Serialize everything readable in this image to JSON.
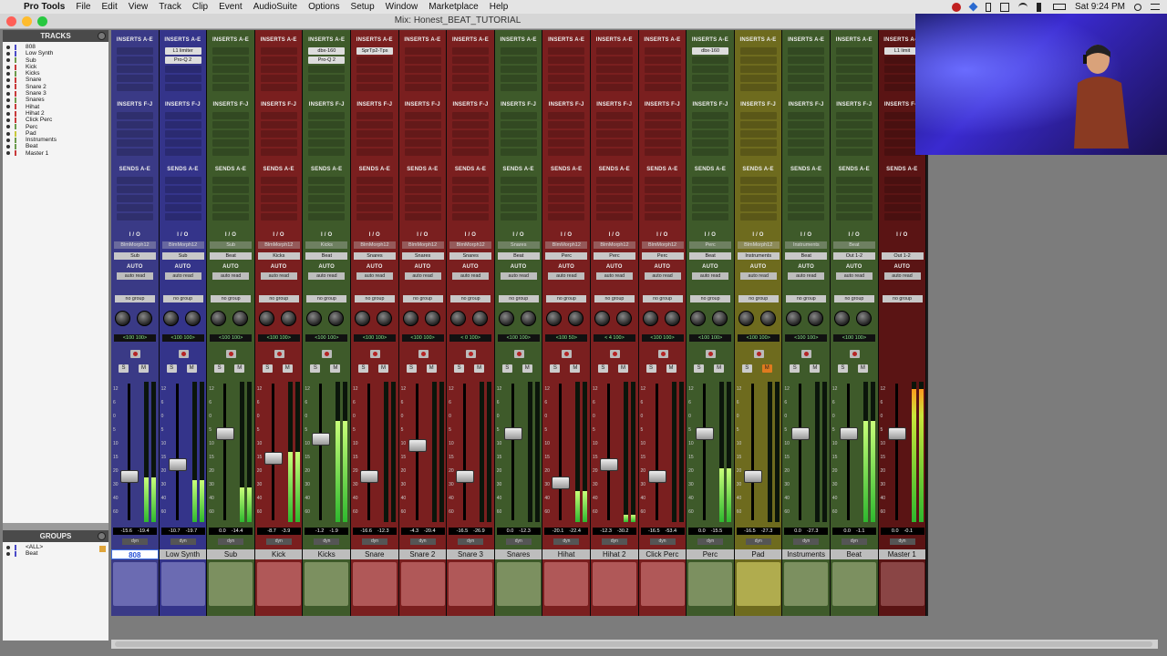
{
  "menubar": {
    "app": "Pro Tools",
    "items": [
      "File",
      "Edit",
      "View",
      "Track",
      "Clip",
      "Event",
      "AudioSuite",
      "Options",
      "Setup",
      "Window",
      "Marketplace",
      "Help"
    ],
    "clock": "Sat 9:24 PM"
  },
  "window": {
    "title": "Mix: Honest_BEAT_TUTORIAL"
  },
  "sidebar": {
    "tracks_header": "TRACKS",
    "tracks": [
      {
        "name": "808",
        "color": "#4a4ac8"
      },
      {
        "name": "Low Synth",
        "color": "#4a4ac8"
      },
      {
        "name": "Sub",
        "color": "#6c9a4c"
      },
      {
        "name": "Kick",
        "color": "#c83a3a"
      },
      {
        "name": "Kicks",
        "color": "#6c9a4c"
      },
      {
        "name": "Snare",
        "color": "#c83a3a"
      },
      {
        "name": "Snare 2",
        "color": "#c83a3a"
      },
      {
        "name": "Snare 3",
        "color": "#c83a3a"
      },
      {
        "name": "Snares",
        "color": "#6c9a4c"
      },
      {
        "name": "Hihat",
        "color": "#c83a3a"
      },
      {
        "name": "Hihat 2",
        "color": "#c83a3a"
      },
      {
        "name": "Click Perc",
        "color": "#c83a3a"
      },
      {
        "name": "Perc",
        "color": "#6c9a4c"
      },
      {
        "name": "Pad",
        "color": "#c8c83a"
      },
      {
        "name": "Instruments",
        "color": "#6c9a4c"
      },
      {
        "name": "Beat",
        "color": "#6c9a4c"
      },
      {
        "name": "Master 1",
        "color": "#c83a3a"
      }
    ],
    "groups_header": "GROUPS",
    "groups": [
      {
        "name": "<ALL>"
      },
      {
        "name": "Beat"
      }
    ]
  },
  "labels": {
    "inserts_ae": "INSERTS A-E",
    "inserts_fj": "INSERTS F-J",
    "sends": "SENDS A-E",
    "io": "I / O",
    "auto": "AUTO",
    "auto_mode": "auto read",
    "group": "no group",
    "solo": "S",
    "mute": "M",
    "dyn": "dyn"
  },
  "strips": [
    {
      "name": "808",
      "color": "#3a3a86",
      "block": "#6b6bb2",
      "inserts": [],
      "input": "BlmMorph12",
      "output": "Sub",
      "pan": "<100  100>",
      "vol": "-15.6",
      "peak": "-19.4",
      "fader": 0.3,
      "meter": 0.32,
      "selected": true
    },
    {
      "name": "Low Synth",
      "color": "#34348a",
      "block": "#6b6bb2",
      "inserts": [
        "L1 limiter",
        "Pro-Q 2"
      ],
      "input": "BlmMorph12",
      "output": "Sub",
      "pan": "<100  100>",
      "vol": "-10.7",
      "peak": "-19.7",
      "fader": 0.4,
      "meter": 0.3
    },
    {
      "name": "Sub",
      "color": "#3e5a2a",
      "block": "#7c9060",
      "inserts": [],
      "input": "Sub",
      "output": "Beat",
      "pan": "<100  100>",
      "vol": "0.0",
      "peak": "-14.4",
      "fader": 0.65,
      "meter": 0.25
    },
    {
      "name": "Kick",
      "color": "#7a1f1f",
      "block": "#b05858",
      "inserts": [],
      "input": "BlmMorph12",
      "output": "Kicks",
      "pan": "<100  100>",
      "vol": "-8.7",
      "peak": "-3.9",
      "fader": 0.45,
      "meter": 0.5
    },
    {
      "name": "Kicks",
      "color": "#3e5a2a",
      "block": "#7c9060",
      "inserts": [
        "dbx-160",
        "Pro-Q 2"
      ],
      "input": "Kicks",
      "output": "Beat",
      "pan": "<100  100>",
      "vol": "-1.2",
      "peak": "-1.9",
      "fader": 0.6,
      "meter": 0.72
    },
    {
      "name": "Snare",
      "color": "#7a1f1f",
      "block": "#b05858",
      "inserts": [
        "SprTp2-Tps"
      ],
      "input": "BlmMorph12",
      "output": "Snares",
      "pan": "<100  100>",
      "vol": "-16.6",
      "peak": "-12.3",
      "fader": 0.3,
      "meter": 0.0
    },
    {
      "name": "Snare 2",
      "color": "#7a1f1f",
      "block": "#b05858",
      "inserts": [],
      "input": "BlmMorph12",
      "output": "Snares",
      "pan": "<100  100>",
      "vol": "-4.3",
      "peak": "-20.4",
      "fader": 0.55,
      "meter": 0.0
    },
    {
      "name": "Snare 3",
      "color": "#7a1f1f",
      "block": "#b05858",
      "inserts": [],
      "input": "BlmMorph12",
      "output": "Snares",
      "pan": "<  0  100>",
      "vol": "-16.5",
      "peak": "-26.9",
      "fader": 0.3,
      "meter": 0.0
    },
    {
      "name": "Snares",
      "color": "#3e5a2a",
      "block": "#7c9060",
      "inserts": [],
      "input": "Snares",
      "output": "Beat",
      "pan": "<100  100>",
      "vol": "0.0",
      "peak": "-12.3",
      "fader": 0.65,
      "meter": 0.0
    },
    {
      "name": "Hihat",
      "color": "#7a1f1f",
      "block": "#b05858",
      "inserts": [],
      "input": "BlmMorph12",
      "output": "Perc",
      "pan": "<100   50>",
      "vol": "-20.1",
      "peak": "-22.4",
      "fader": 0.25,
      "meter": 0.22
    },
    {
      "name": "Hihat 2",
      "color": "#7a1f1f",
      "block": "#b05858",
      "inserts": [],
      "input": "BlmMorph12",
      "output": "Perc",
      "pan": "<  4  100>",
      "vol": "-12.3",
      "peak": "-30.2",
      "fader": 0.4,
      "meter": 0.05
    },
    {
      "name": "Click Perc",
      "color": "#7a1f1f",
      "block": "#b05858",
      "inserts": [],
      "input": "BlmMorph12",
      "output": "Perc",
      "pan": "<100  100>",
      "vol": "-16.5",
      "peak": "-53.4",
      "fader": 0.3,
      "meter": 0.0
    },
    {
      "name": "Perc",
      "color": "#3e5a2a",
      "block": "#7c9060",
      "inserts": [
        "dbx-160"
      ],
      "input": "Perc",
      "output": "Beat",
      "pan": "<100  100>",
      "vol": "0.0",
      "peak": "-15.5",
      "fader": 0.65,
      "meter": 0.38
    },
    {
      "name": "Pad",
      "color": "#6e6b1e",
      "block": "#b0ac4e",
      "inserts": [],
      "input": "BlmMorph12",
      "output": "Instruments",
      "pan": "<100  100>",
      "vol": "-16.5",
      "peak": "-27.3",
      "fader": 0.3,
      "meter": 0.0,
      "muted": true
    },
    {
      "name": "Instruments",
      "color": "#3e5a2a",
      "block": "#7c9060",
      "inserts": [],
      "input": "Instruments",
      "output": "Beat",
      "pan": "<100  100>",
      "vol": "0.0",
      "peak": "-27.3",
      "fader": 0.65,
      "meter": 0.0
    },
    {
      "name": "Beat",
      "color": "#3e5a2a",
      "block": "#7c9060",
      "inserts": [],
      "input": "Beat",
      "output": "Out 1-2",
      "pan": "<100  100>",
      "vol": "0.0",
      "peak": "-1.1",
      "fader": 0.65,
      "meter": 0.72
    },
    {
      "name": "Master 1",
      "color": "#5a1414",
      "block": "#8a4545",
      "inserts": [
        "L1 limit"
      ],
      "input": "",
      "output": "Out 1-2",
      "pan": "",
      "vol": "0.0",
      "peak": "-0.1",
      "fader": 0.65,
      "meter": 0.95,
      "master": true
    }
  ],
  "colors": {
    "mixer_bg": "#1d1d1d",
    "meter": "#2eb82e",
    "selected_name": "#234fd9"
  },
  "scale": [
    "12",
    "6",
    "0",
    "5",
    "10",
    "15",
    "20",
    "30",
    "40",
    "60"
  ]
}
